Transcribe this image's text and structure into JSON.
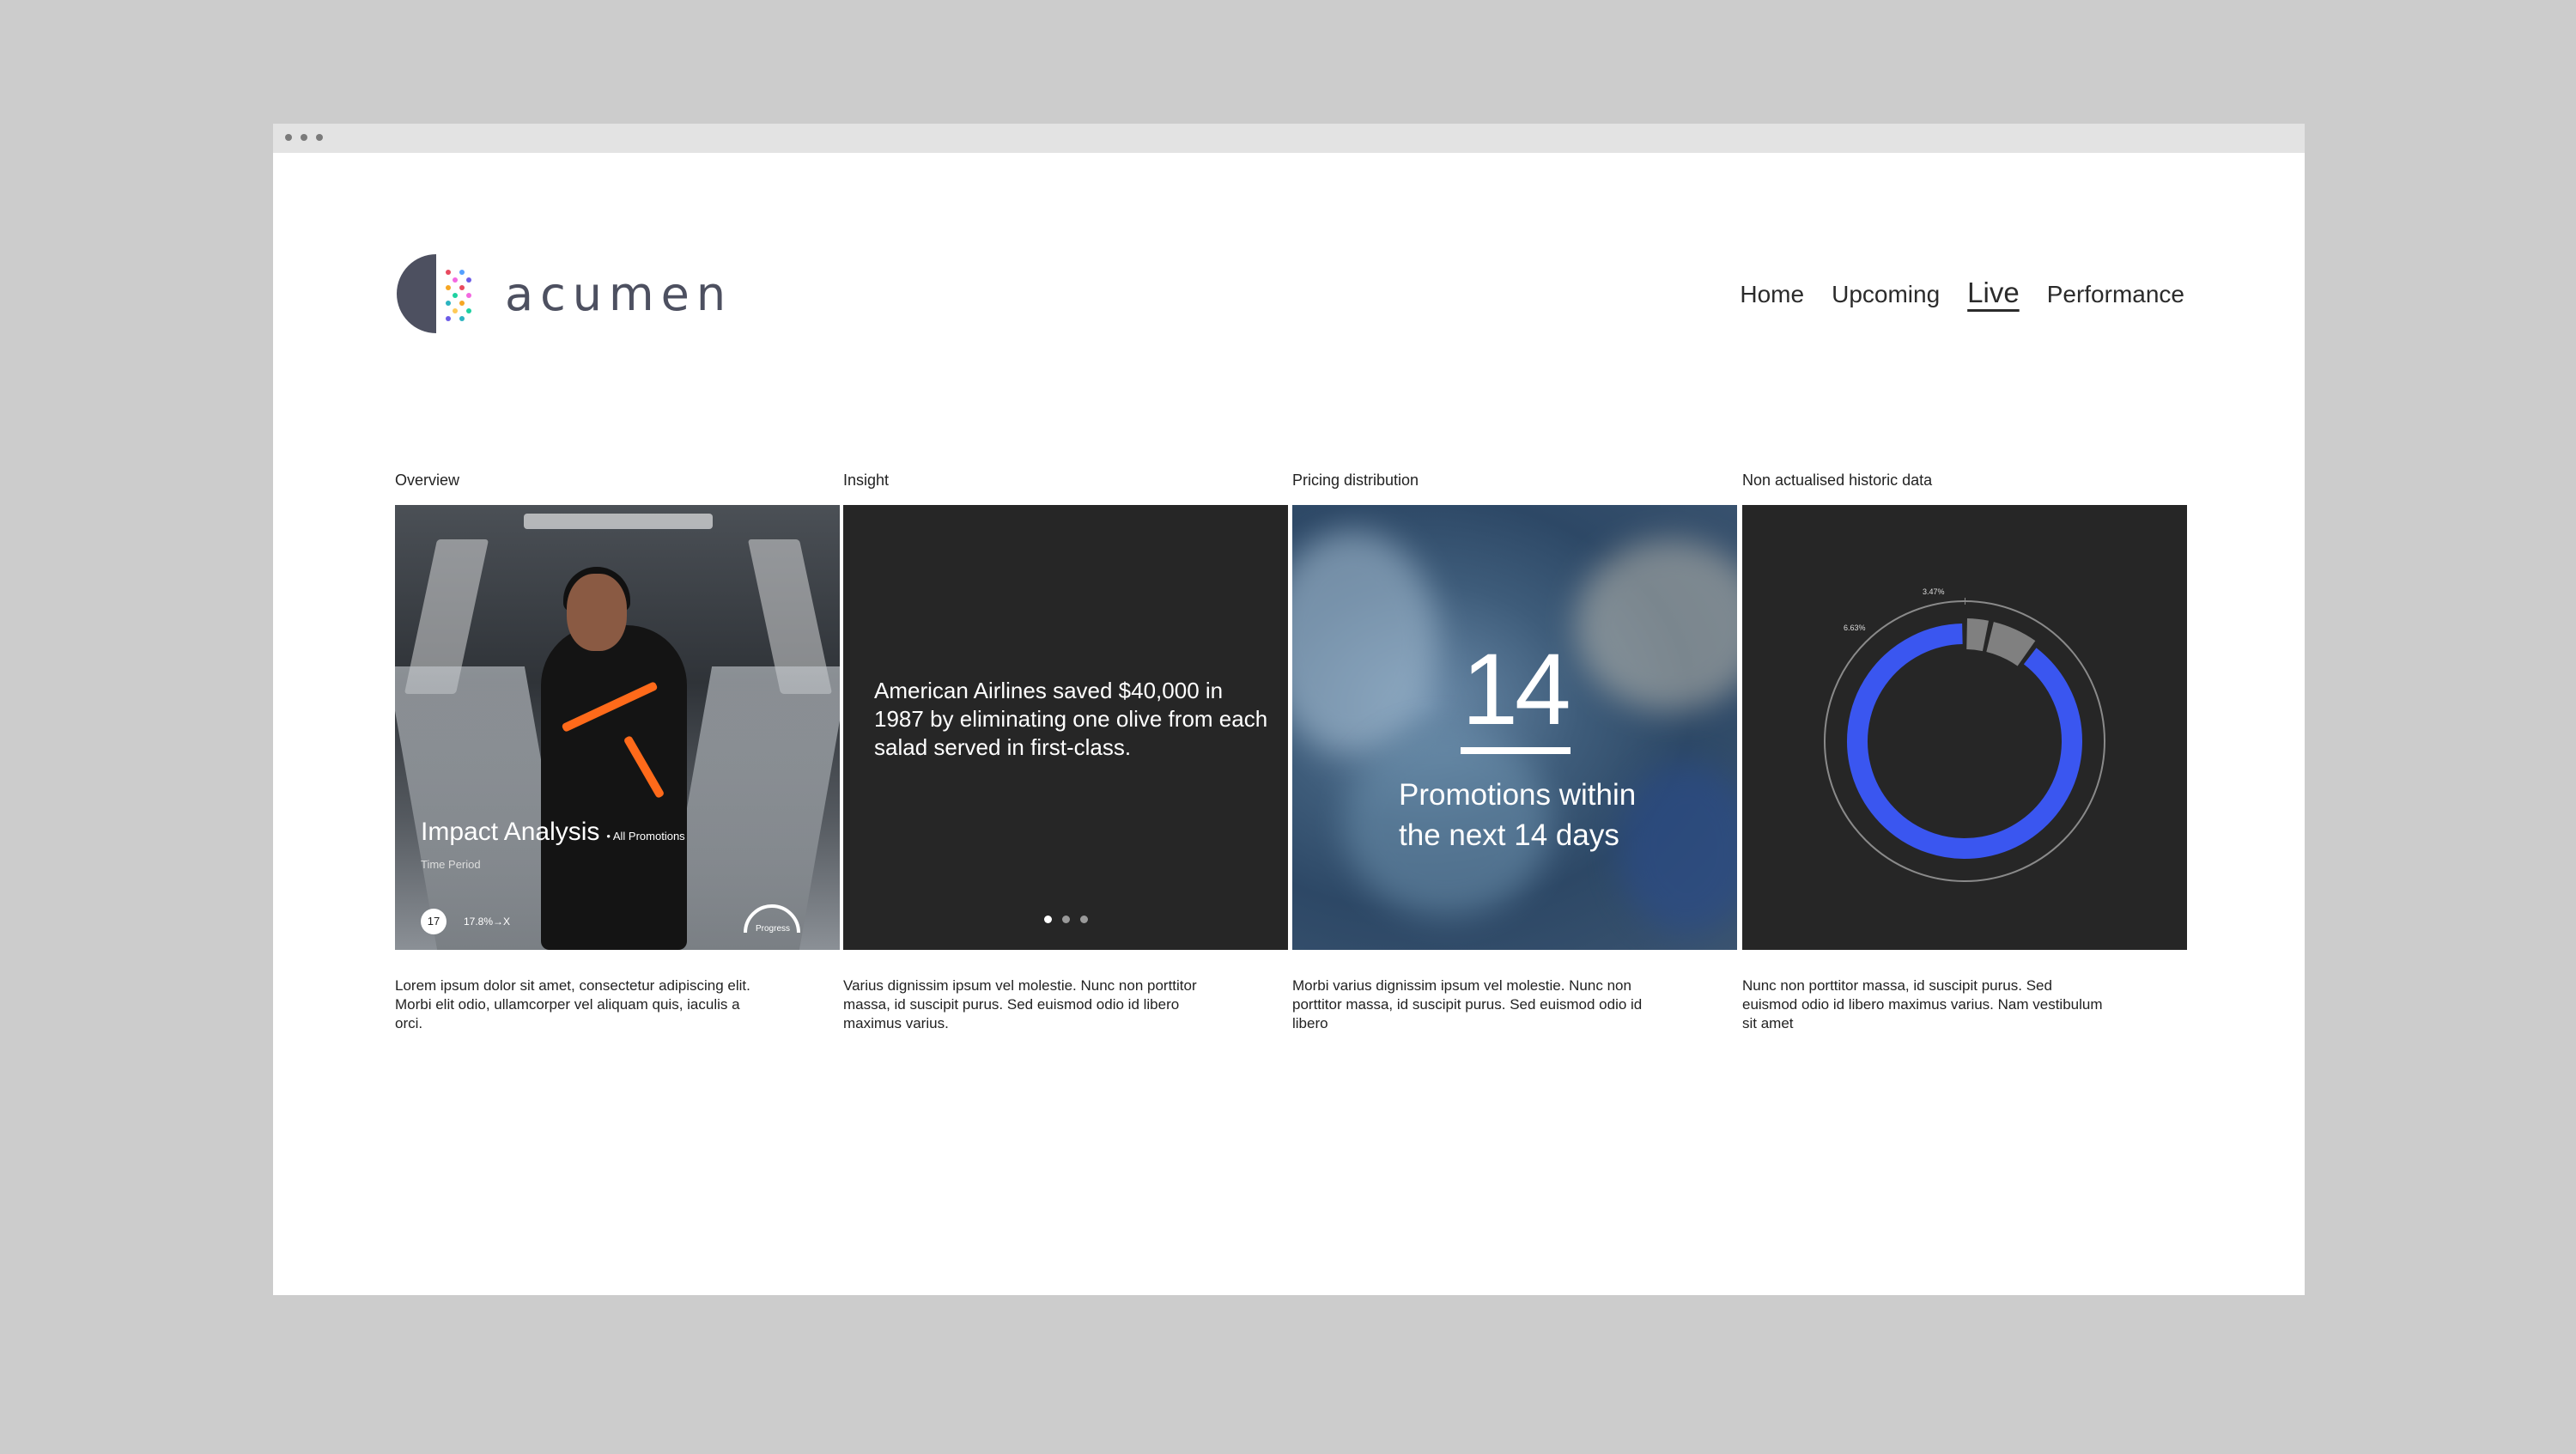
{
  "brand": {
    "name": "acumen",
    "colors": {
      "accent": "#3a56f0",
      "text": "#4d5060",
      "background": "#cccccc"
    }
  },
  "nav": {
    "items": [
      {
        "label": "Home",
        "active": false
      },
      {
        "label": "Upcoming",
        "active": false
      },
      {
        "label": "Live",
        "active": true
      },
      {
        "label": "Performance",
        "active": false
      }
    ]
  },
  "sections": [
    {
      "label": "Overview",
      "description": "Lorem ipsum dolor sit amet, consectetur adipiscing elit. Morbi elit odio, ullamcorper vel aliquam quis, iaculis a orci.",
      "card": {
        "title": "Impact Analysis",
        "tag": "• All Promotions",
        "subtitle": "Time Period",
        "badge": "17",
        "range": "17.8%→X",
        "progress_label": "Progress",
        "icons": [
          "calendar-badge-icon",
          "progress-gauge-icon"
        ]
      }
    },
    {
      "label": "Insight",
      "description": "Varius dignissim ipsum vel molestie. Nunc non porttitor massa, id suscipit purus. Sed euismod odio id libero maximus varius.",
      "card": {
        "quote": "American Airlines saved $40,000 in 1987 by eliminating one olive from each salad served in first-class.",
        "slides": 3,
        "active_slide": 1
      }
    },
    {
      "label": "Pricing distribution",
      "description": "Morbi varius dignissim ipsum vel molestie. Nunc non porttitor massa, id suscipit purus. Sed euismod odio id libero",
      "card": {
        "number": "14",
        "text": "Promotions within the next 14 days"
      }
    },
    {
      "label": "Non actualised historic data",
      "description": "Nunc non porttitor massa, id suscipit purus. Sed euismod odio id libero maximus varius. Nam vestibulum sit amet",
      "card": {
        "labels": [
          "3.47%",
          "6.63%"
        ]
      }
    }
  ],
  "chart_data": {
    "type": "pie",
    "labels": [
      "3.47%",
      "6.63%"
    ],
    "slices": [
      {
        "value": 3.47,
        "color": "#808080"
      },
      {
        "value": 6.63,
        "color": "#808080"
      },
      {
        "value": 89.9,
        "color": "#3a56f0"
      }
    ]
  }
}
